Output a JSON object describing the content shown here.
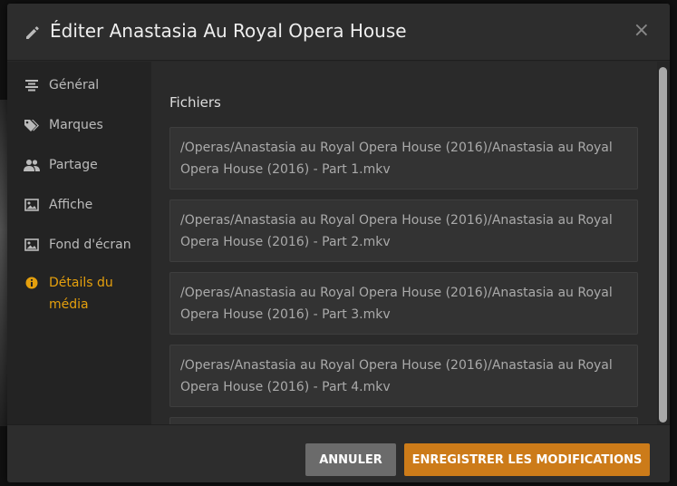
{
  "dialog": {
    "title": "Éditer Anastasia Au Royal Opera House",
    "close_symbol": "×"
  },
  "sidebar": {
    "items": [
      {
        "label": "Général",
        "icon": "align-center-icon"
      },
      {
        "label": "Marques",
        "icon": "tags-icon"
      },
      {
        "label": "Partage",
        "icon": "users-icon"
      },
      {
        "label": "Affiche",
        "icon": "image-icon"
      },
      {
        "label": "Fond d'écran",
        "icon": "image-icon"
      },
      {
        "label": "Détails du média",
        "icon": "info-icon",
        "active": true
      }
    ]
  },
  "main": {
    "section_title": "Fichiers",
    "files": [
      "/Operas/Anastasia au Royal Opera House (2016)/Anastasia au Royal Opera House (2016) - Part 1.mkv",
      "/Operas/Anastasia au Royal Opera House (2016)/Anastasia au Royal Opera House (2016) - Part 2.mkv",
      "/Operas/Anastasia au Royal Opera House (2016)/Anastasia au Royal Opera House (2016) - Part 3.mkv",
      "/Operas/Anastasia au Royal Opera House (2016)/Anastasia au Royal Opera House (2016) - Part 4.mkv",
      ""
    ]
  },
  "footer": {
    "cancel_label": "ANNULER",
    "save_label": "ENREGISTRER LES MODIFICATIONS"
  },
  "colors": {
    "accent": "#e5a00d",
    "save_button": "#cc7b19",
    "cancel_button": "#6b6b6b"
  }
}
